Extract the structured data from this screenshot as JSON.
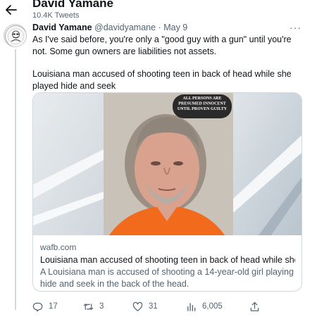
{
  "header": {
    "title": "David Yamane",
    "subtitle": "10.4K Tweets"
  },
  "tweet": {
    "display_name": "David Yamane",
    "handle": "@davidyamane",
    "separator": "·",
    "date": "May 9",
    "more": "···",
    "text_line1": "As I've said before, you're only a \"good guy with a gun\" until you're not. Some gun owners are liabilities not assets.",
    "text_line2": "Louisiana man accused of shooting teen in back of head while she played hide and seek",
    "card": {
      "badge_text": "ALL PERSONS ARE PRESUMED INNOCENT UNTIL PROVEN GUILTY",
      "domain": "wafb.com",
      "title": "Louisiana man accused of shooting teen in back of head while she pl...",
      "description": "A Louisiana man is accused of shooting a 14-year-old girl playing hide and seek in the back of the head."
    },
    "actions": {
      "replies": "17",
      "retweets": "3",
      "likes": "31",
      "views": "6,005"
    }
  },
  "colors": {
    "text_primary": "#0f1419",
    "text_secondary": "#536471",
    "border": "#cfd9de",
    "mugshot_background": "#c8c2b8",
    "shirt": "#f26a1c"
  },
  "icons": [
    "back-arrow-icon",
    "more-icon",
    "reply-icon",
    "retweet-icon",
    "like-icon",
    "views-icon",
    "share-icon"
  ]
}
